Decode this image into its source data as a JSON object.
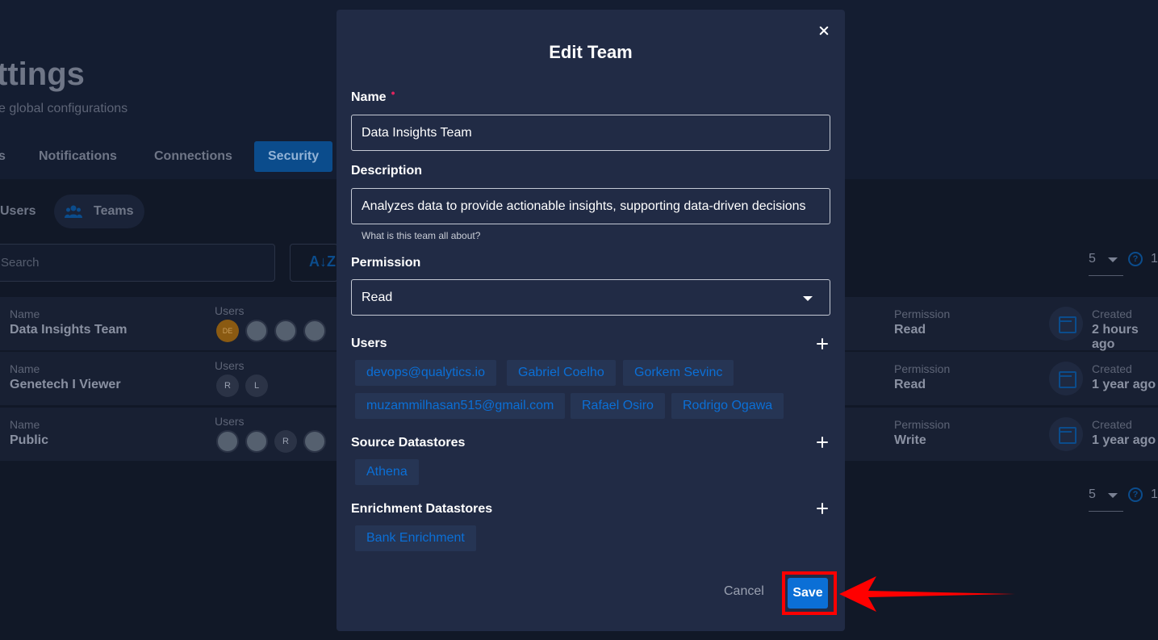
{
  "background": {
    "page_title": "ttings",
    "page_subtitle": "e global configurations",
    "tabs": [
      {
        "label": "s"
      },
      {
        "label": "Notifications"
      },
      {
        "label": "Connections"
      },
      {
        "label": "Security"
      }
    ],
    "subtabs": {
      "users": "Users",
      "teams": "Teams"
    },
    "search_placeholder": "Search",
    "sort_glyph": "A↓Z",
    "pager": {
      "page_size": "5",
      "help": "?",
      "page": "1"
    },
    "rows": [
      {
        "name_label": "Name",
        "name": "Data Insights Team",
        "users_label": "Users",
        "avatars": [
          "DE",
          "",
          "",
          ""
        ],
        "permission_label": "Permission",
        "permission": "Read",
        "created_label": "Created",
        "created": "2 hours ago"
      },
      {
        "name_label": "Name",
        "name": "Genetech I Viewer",
        "users_label": "Users",
        "avatars": [
          "R",
          "L"
        ],
        "permission_label": "Permission",
        "permission": "Read",
        "created_label": "Created",
        "created": "1 year ago"
      },
      {
        "name_label": "Name",
        "name": "Public",
        "users_label": "Users",
        "avatars": [
          "",
          "",
          "R",
          ""
        ],
        "permission_label": "Permission",
        "permission": "Write",
        "created_label": "Created",
        "created": "1 year ago"
      }
    ]
  },
  "modal": {
    "title": "Edit Team",
    "name_label": "Name",
    "required_mark": "•",
    "name_value": "Data Insights Team",
    "description_label": "Description",
    "description_value": "Analyzes data to provide actionable insights, supporting data-driven decisions",
    "description_helper": "What is this team all about?",
    "permission_label": "Permission",
    "permission_value": "Read",
    "users_label": "Users",
    "users": [
      "devops@qualytics.io",
      "Gabriel Coelho",
      "Gorkem Sevinc",
      "muzammilhasan515@gmail.com",
      "Rafael Osiro",
      "Rodrigo Ogawa"
    ],
    "source_label": "Source Datastores",
    "source_datastores": [
      "Athena"
    ],
    "enrichment_label": "Enrichment Datastores",
    "enrichment_datastores": [
      "Bank Enrichment"
    ],
    "cancel_label": "Cancel",
    "save_label": "Save"
  },
  "colors": {
    "accent": "#0b6fd6",
    "annotation": "#ff0000",
    "modal_bg": "#212b45",
    "page_bg": "#111827"
  }
}
